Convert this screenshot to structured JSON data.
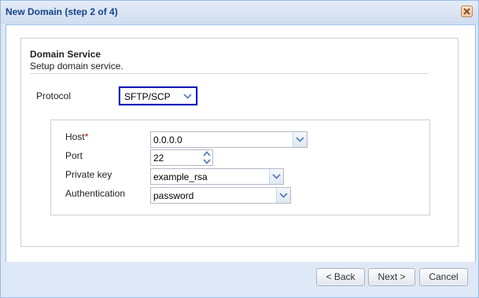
{
  "window": {
    "title": "New Domain (step 2 of 4)"
  },
  "section": {
    "title": "Domain Service",
    "subtitle": "Setup domain service."
  },
  "protocol": {
    "label": "Protocol",
    "value": "SFTP/SCP"
  },
  "fields": {
    "host": {
      "label": "Host",
      "required_mark": "*",
      "value": "0.0.0.0"
    },
    "port": {
      "label": "Port",
      "value": "22"
    },
    "private_key": {
      "label": "Private key",
      "value": "example_rsa"
    },
    "authentication": {
      "label": "Authentication",
      "value": "password"
    }
  },
  "buttons": {
    "back": "< Back",
    "next": "Next >",
    "cancel": "Cancel"
  },
  "colors": {
    "accent": "#15428b",
    "focus_border": "#1d1bb8",
    "required": "#cc0000"
  },
  "icons": {
    "close": "close-icon",
    "dropdown": "chevron-down-icon",
    "spinner": "spinner-arrows-icon"
  }
}
